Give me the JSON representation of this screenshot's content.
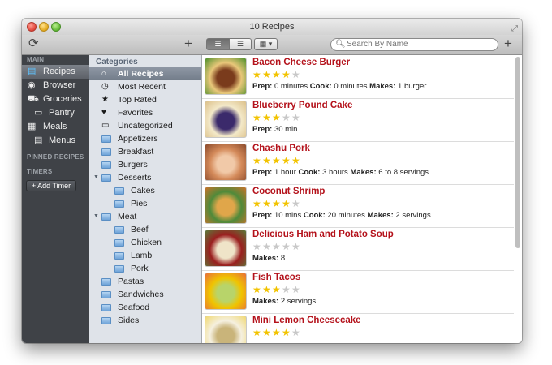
{
  "window": {
    "title": "10 Recipes"
  },
  "toolbar": {
    "sync_icon": "sync-icon",
    "add_recipe_icon": "plus-icon",
    "view_modes": [
      "list",
      "detail",
      "grid"
    ],
    "search_placeholder": "Search By Name",
    "add_icon": "plus-icon"
  },
  "sidebar": {
    "main_header": "MAIN",
    "items": [
      {
        "label": "Recipes",
        "icon": "book-icon",
        "active": true
      },
      {
        "label": "Browser",
        "icon": "globe-icon"
      },
      {
        "label": "Groceries",
        "icon": "cart-icon"
      },
      {
        "label": "Pantry",
        "icon": "pantry-icon",
        "sub": true
      },
      {
        "label": "Meals",
        "icon": "calendar-icon"
      },
      {
        "label": "Menus",
        "icon": "menu-icon",
        "sub": true
      }
    ],
    "pinned_header": "PINNED RECIPES",
    "timers_header": "TIMERS",
    "add_timer_label": "+ Add Timer"
  },
  "categories": {
    "header": "Categories",
    "items": [
      {
        "label": "All Recipes",
        "icon": "home-icon",
        "active": true
      },
      {
        "label": "Most Recent",
        "icon": "clock-icon"
      },
      {
        "label": "Top Rated",
        "icon": "star-icon"
      },
      {
        "label": "Favorites",
        "icon": "heart-icon"
      },
      {
        "label": "Uncategorized",
        "icon": "tray-icon"
      },
      {
        "label": "Appetizers",
        "icon": "folder-icon"
      },
      {
        "label": "Breakfast",
        "icon": "folder-icon"
      },
      {
        "label": "Burgers",
        "icon": "folder-icon"
      },
      {
        "label": "Desserts",
        "icon": "folder-icon",
        "expanded": true
      },
      {
        "label": "Cakes",
        "icon": "folder-icon",
        "level": 1
      },
      {
        "label": "Pies",
        "icon": "folder-icon",
        "level": 1
      },
      {
        "label": "Meat",
        "icon": "folder-icon",
        "expanded": true
      },
      {
        "label": "Beef",
        "icon": "folder-icon",
        "level": 1
      },
      {
        "label": "Chicken",
        "icon": "folder-icon",
        "level": 1
      },
      {
        "label": "Lamb",
        "icon": "folder-icon",
        "level": 1
      },
      {
        "label": "Pork",
        "icon": "folder-icon",
        "level": 1
      },
      {
        "label": "Pastas",
        "icon": "folder-icon"
      },
      {
        "label": "Sandwiches",
        "icon": "folder-icon"
      },
      {
        "label": "Seafood",
        "icon": "folder-icon"
      },
      {
        "label": "Sides",
        "icon": "folder-icon"
      }
    ]
  },
  "recipes": [
    {
      "title": "Bacon Cheese Burger",
      "rating": 4,
      "meta": [
        {
          "k": "Prep:",
          "v": "0 minutes"
        },
        {
          "k": "Cook:",
          "v": "0 minutes"
        },
        {
          "k": "Makes:",
          "v": "1 burger"
        }
      ],
      "thumb_colors": [
        "#e9c77a",
        "#7a3b1c",
        "#4d8f2a"
      ]
    },
    {
      "title": "Blueberry Pound Cake",
      "rating": 3,
      "meta": [
        {
          "k": "Prep:",
          "v": "30 min"
        }
      ],
      "thumb_colors": [
        "#f3e9c9",
        "#3b2a6b",
        "#dcc089"
      ]
    },
    {
      "title": "Chashu Pork",
      "rating": 5,
      "meta": [
        {
          "k": "Prep:",
          "v": "1 hour"
        },
        {
          "k": "Cook:",
          "v": "3 hours"
        },
        {
          "k": "Makes:",
          "v": "6 to 8 servings"
        }
      ],
      "thumb_colors": [
        "#d48a5a",
        "#f1c9a8",
        "#8b4a2b"
      ]
    },
    {
      "title": "Coconut Shrimp",
      "rating": 4,
      "meta": [
        {
          "k": "Prep:",
          "v": "10 mins"
        },
        {
          "k": "Cook:",
          "v": "20 minutes"
        },
        {
          "k": "Makes:",
          "v": "2 servings"
        }
      ],
      "thumb_colors": [
        "#4f8a3a",
        "#e0a64a",
        "#c9732a"
      ]
    },
    {
      "title": "Delicious Ham and Potato Soup",
      "rating": 0,
      "meta": [
        {
          "k": "Makes:",
          "v": "8"
        }
      ],
      "thumb_colors": [
        "#9a1f1f",
        "#efe4c8",
        "#5a7a3a"
      ]
    },
    {
      "title": "Fish Tacos",
      "rating": 3,
      "meta": [
        {
          "k": "Makes:",
          "v": "2 servings"
        }
      ],
      "thumb_colors": [
        "#f0c400",
        "#b8d46a",
        "#e8703a"
      ]
    },
    {
      "title": "Mini Lemon Cheesecake",
      "rating": 4,
      "meta": [],
      "thumb_colors": [
        "#f5f0e0",
        "#c9b47a",
        "#f0d870"
      ]
    }
  ],
  "colors": {
    "recipe_title": "#b4121b",
    "star_on": "#f2c300",
    "star_off": "#c8c8c8",
    "sidebar_bg": "#3f4247",
    "categories_bg": "#dfe3e9"
  }
}
